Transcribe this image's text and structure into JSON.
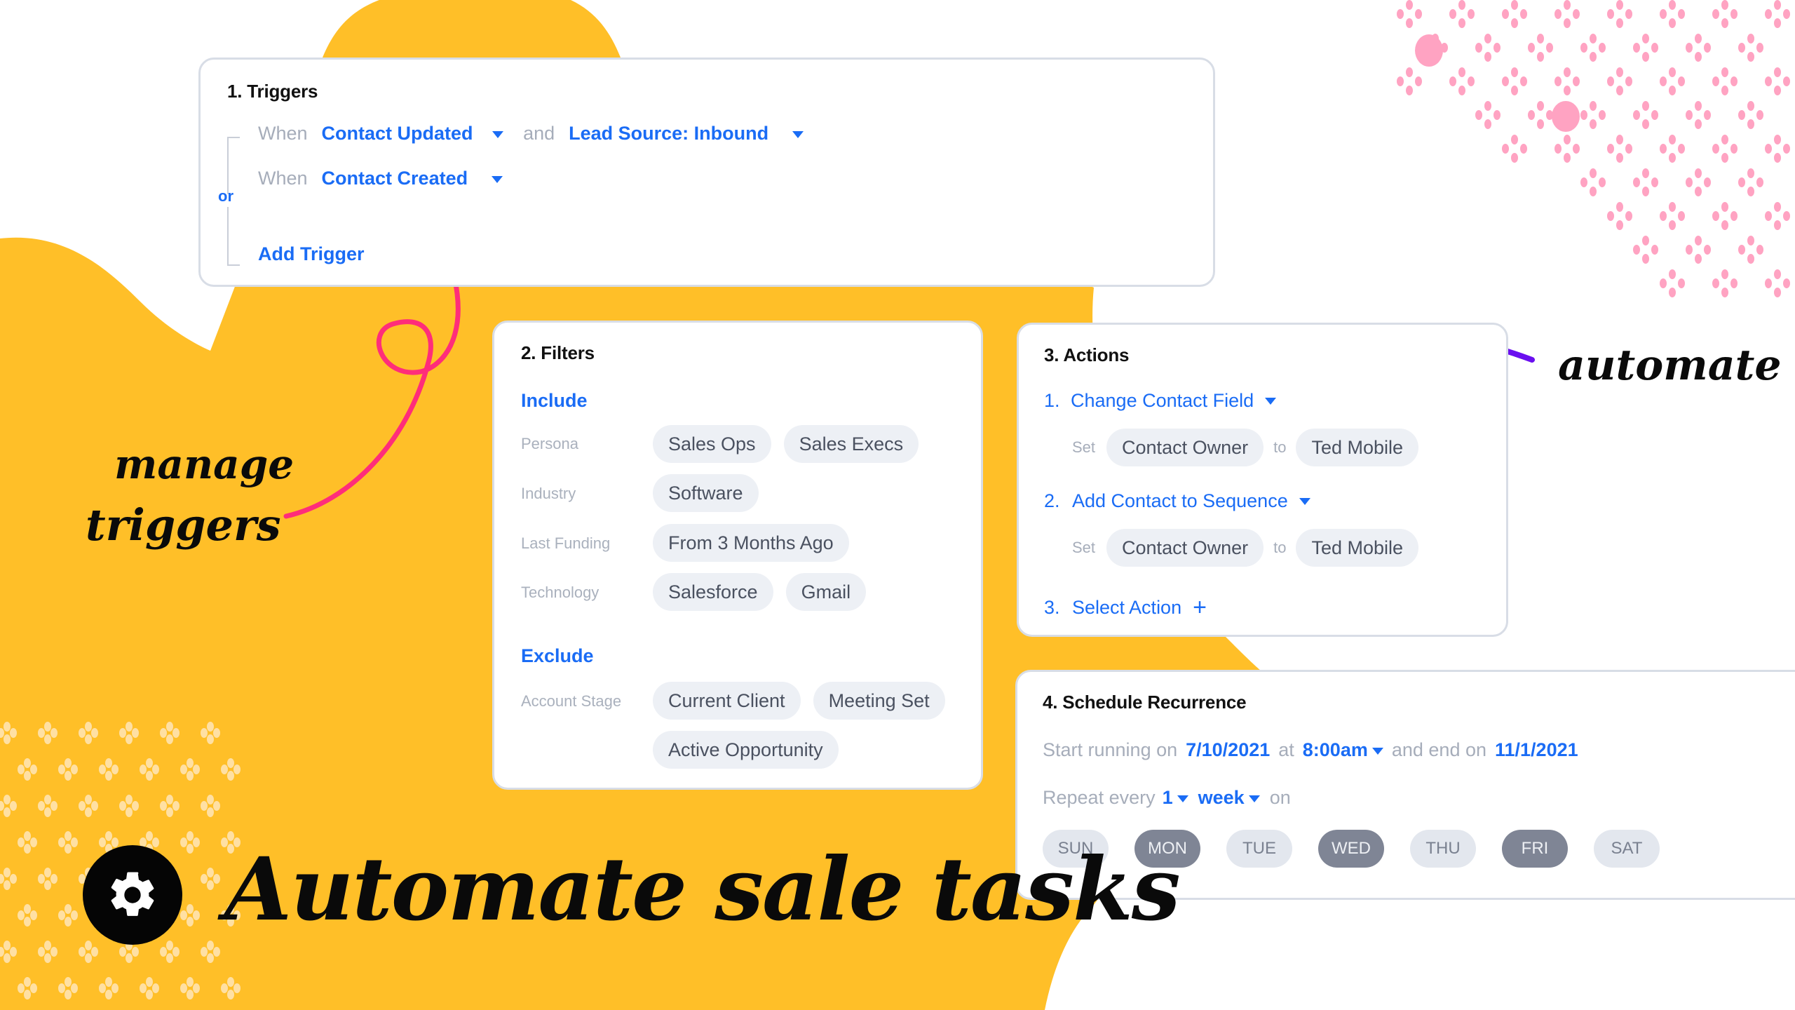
{
  "colors": {
    "background_yellow": "#FFBF28",
    "accent_blue": "#1A6CF5",
    "pink_dots": "#FFA3C2",
    "pink_arrow": "#FF2D7A",
    "purple_arrow": "#6A0FEF",
    "pill_bg": "#EDF0F5",
    "day_selected": "#7F8595"
  },
  "triggers": {
    "title": "1. Triggers",
    "or_label": "or",
    "rows": [
      {
        "when": "When",
        "event": "Contact Updated",
        "and": "and",
        "condition": "Lead Source: Inbound"
      },
      {
        "when": "When",
        "event": "Contact Created"
      }
    ],
    "add_trigger": "Add Trigger"
  },
  "filters": {
    "title": "2. Filters",
    "include_label": "Include",
    "include": [
      {
        "label": "Persona",
        "values": [
          "Sales Ops",
          "Sales Execs"
        ]
      },
      {
        "label": "Industry",
        "values": [
          "Software"
        ]
      },
      {
        "label": "Last Funding",
        "values": [
          "From 3 Months Ago"
        ]
      },
      {
        "label": "Technology",
        "values": [
          "Salesforce",
          "Gmail"
        ]
      }
    ],
    "exclude_label": "Exclude",
    "exclude": [
      {
        "label": "Account Stage",
        "values": [
          "Current Client",
          "Meeting Set",
          "Active Opportunity"
        ]
      }
    ]
  },
  "actions": {
    "title": "3. Actions",
    "items": [
      {
        "num": "1.",
        "name": "Change Contact Field",
        "set": "Set",
        "field": "Contact Owner",
        "to": "to",
        "value": "Ted Mobile"
      },
      {
        "num": "2.",
        "name": "Add Contact to Sequence",
        "set": "Set",
        "field": "Contact Owner",
        "to": "to",
        "value": "Ted Mobile"
      }
    ],
    "add": {
      "num": "3.",
      "name": "Select Action",
      "icon": "plus-icon"
    }
  },
  "schedule": {
    "title": "4. Schedule Recurrence",
    "start_label": "Start running on",
    "start_date": "7/10/2021",
    "at_label": "at",
    "time": "8:00am",
    "end_label": "and end on",
    "end_date": "11/1/2021",
    "repeat_label": "Repeat every",
    "repeat_count": "1",
    "repeat_unit": "week",
    "on_label": "on",
    "days": [
      {
        "label": "SUN",
        "selected": false
      },
      {
        "label": "MON",
        "selected": true
      },
      {
        "label": "TUE",
        "selected": false
      },
      {
        "label": "WED",
        "selected": true
      },
      {
        "label": "THU",
        "selected": false
      },
      {
        "label": "FRI",
        "selected": true
      },
      {
        "label": "SAT",
        "selected": false
      }
    ]
  },
  "annotations": {
    "manage_line1": "manage",
    "manage_line2": "triggers",
    "automate": "automate"
  },
  "headline": {
    "icon": "gear-icon",
    "text": "Automate sale tasks"
  }
}
